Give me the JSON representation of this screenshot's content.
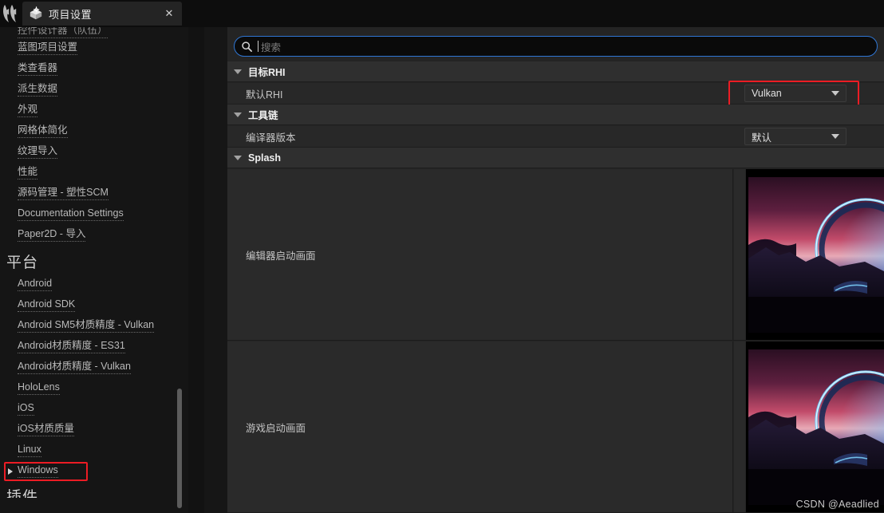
{
  "window": {
    "app_logo": "unreal-engine-logo",
    "tab": {
      "icon": "project-settings-icon",
      "title": "项目设置",
      "close_label": "✕"
    }
  },
  "sidebar": {
    "clipped_top_item": "控件设计器（队伍）",
    "items": [
      {
        "label": "蓝图项目设置"
      },
      {
        "label": "类查看器"
      },
      {
        "label": "派生数据"
      },
      {
        "label": "外观"
      },
      {
        "label": "网格体简化"
      },
      {
        "label": "纹理导入"
      },
      {
        "label": "性能"
      },
      {
        "label": "源码管理 - 塑性SCM"
      },
      {
        "label": "Documentation Settings"
      },
      {
        "label": "Paper2D - 导入"
      }
    ],
    "platform_heading": "平台",
    "platform_items": [
      {
        "label": "Android",
        "selected": false
      },
      {
        "label": "Android SDK",
        "selected": false
      },
      {
        "label": "Android SM5材质精度 - Vulkan",
        "selected": false
      },
      {
        "label": "Android材质精度 - ES31",
        "selected": false
      },
      {
        "label": "Android材质精度 - Vulkan",
        "selected": false
      },
      {
        "label": "HoloLens",
        "selected": false
      },
      {
        "label": "iOS",
        "selected": false
      },
      {
        "label": "iOS材质质量",
        "selected": false
      },
      {
        "label": "Linux",
        "selected": false
      },
      {
        "label": "Windows",
        "selected": true
      }
    ],
    "plugins_heading": "插件"
  },
  "search": {
    "placeholder": "搜索",
    "value": "",
    "icon": "search-icon"
  },
  "main": {
    "sections": [
      {
        "id": "target-rhi",
        "title": "目标RHI",
        "expanded": true,
        "properties": [
          {
            "label": "默认RHI",
            "control": "dropdown",
            "value": "Vulkan",
            "highlighted": true
          }
        ]
      },
      {
        "id": "toolchain",
        "title": "工具链",
        "expanded": true,
        "properties": [
          {
            "label": "编译器版本",
            "control": "dropdown",
            "value": "默认",
            "highlighted": false
          }
        ]
      },
      {
        "id": "splash",
        "title": "Splash",
        "expanded": true,
        "properties": [
          {
            "label": "编辑器启动画面",
            "control": "image"
          },
          {
            "label": "游戏启动画面",
            "control": "image"
          }
        ]
      }
    ]
  },
  "watermark": "CSDN @Aeadlied",
  "colors": {
    "accent_highlight": "#ec1c24",
    "search_focus_border": "#2f76d4",
    "panel_bg": "#242424",
    "category_bg": "#2f2f2f",
    "sidebar_bg": "#151515"
  }
}
